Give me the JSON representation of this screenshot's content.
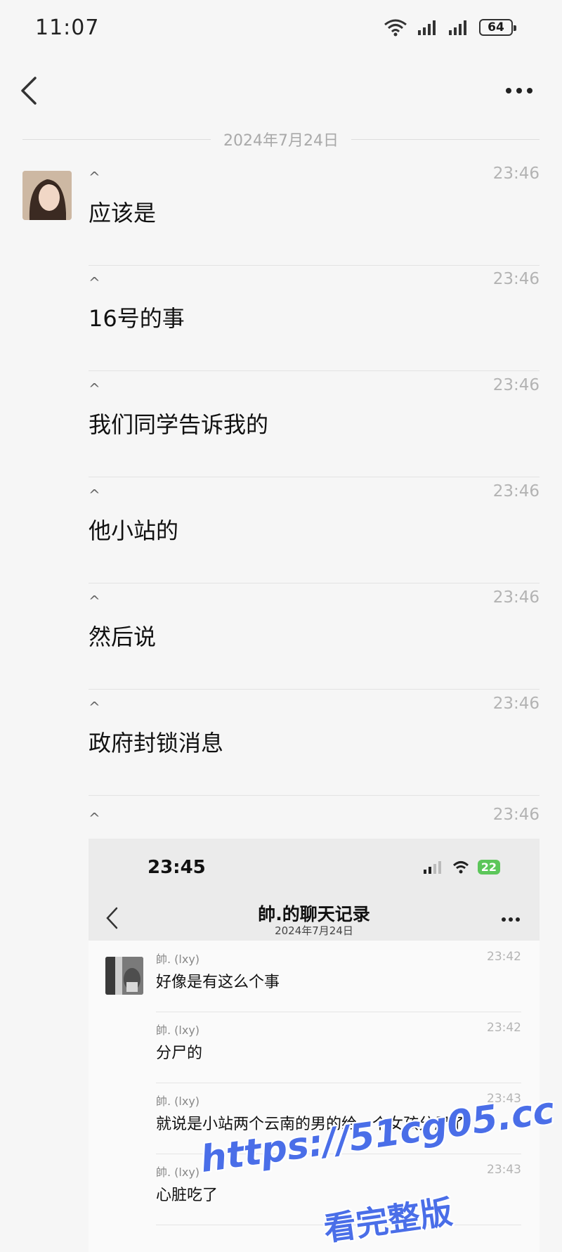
{
  "status_bar": {
    "time": "11:07",
    "battery": "64"
  },
  "date_divider": "2024年7月24日",
  "messages": [
    {
      "sender": "^",
      "time": "23:46",
      "content": "应该是"
    },
    {
      "sender": "^",
      "time": "23:46",
      "content": "16号的事"
    },
    {
      "sender": "^",
      "time": "23:46",
      "content": "我们同学告诉我的"
    },
    {
      "sender": "^",
      "time": "23:46",
      "content": "他小站的"
    },
    {
      "sender": "^",
      "time": "23:46",
      "content": "然后说"
    },
    {
      "sender": "^",
      "time": "23:46",
      "content": "政府封锁消息"
    }
  ],
  "last_message": {
    "sender": "^",
    "time": "23:46"
  },
  "screenshot": {
    "time": "23:45",
    "battery": "22",
    "title": "帥.的聊天记录",
    "subtitle": "2024年7月24日",
    "messages": [
      {
        "sender": "帥. (lxy)",
        "time": "23:42",
        "content": "好像是有这么个事"
      },
      {
        "sender": "帥. (lxy)",
        "time": "23:42",
        "content": "分尸的"
      },
      {
        "sender": "帥. (lxy)",
        "time": "23:43",
        "content": "就说是小站两个云南的男的给一个女孩分尸了"
      },
      {
        "sender": "帥. (lxy)",
        "time": "23:43",
        "content": "心脏吃了"
      }
    ]
  },
  "watermark": {
    "line1": "https://51cg05.cc",
    "line2": "看完整版"
  },
  "colors": {
    "accent_watermark": "#4a6ee8",
    "battery_green": "#5cc65a"
  }
}
